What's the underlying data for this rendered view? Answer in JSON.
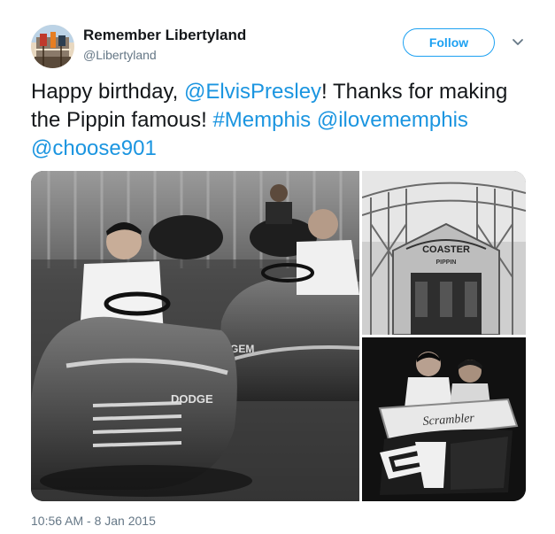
{
  "author": {
    "display_name": "Remember Libertyland",
    "handle": "@Libertyland",
    "avatar_icon": "roller-coaster-avatar"
  },
  "actions": {
    "follow_label": "Follow",
    "menu_icon": "chevron-down-icon"
  },
  "tweet": {
    "segments": [
      {
        "text": "Happy birthday, ",
        "type": "text"
      },
      {
        "text": "@ElvisPresley",
        "type": "mention"
      },
      {
        "text": "! Thanks for making the Pippin famous! ",
        "type": "text"
      },
      {
        "text": "#Memphis",
        "type": "hashtag"
      },
      {
        "text": " ",
        "type": "text"
      },
      {
        "text": "@ilovememphis",
        "type": "mention"
      },
      {
        "text": " ",
        "type": "text"
      },
      {
        "text": "@choose901",
        "type": "mention"
      }
    ]
  },
  "media": {
    "photos": [
      {
        "description": "black-and-white photo of two men driving bumper cars",
        "car_label": "DODGE",
        "car_label_2": "GEM"
      },
      {
        "description": "wooden roller coaster entrance",
        "sign_text": "COASTER",
        "sign_text_2": "PIPPIN"
      },
      {
        "description": "two riders on a Scrambler ride",
        "sign_text": "Scrambler"
      }
    ]
  },
  "meta": {
    "timestamp": "10:56 AM - 8 Jan 2015"
  },
  "colors": {
    "link": "#1b95e0",
    "follow": "#1da1f2",
    "secondary_text": "#657786",
    "primary_text": "#14171a"
  }
}
